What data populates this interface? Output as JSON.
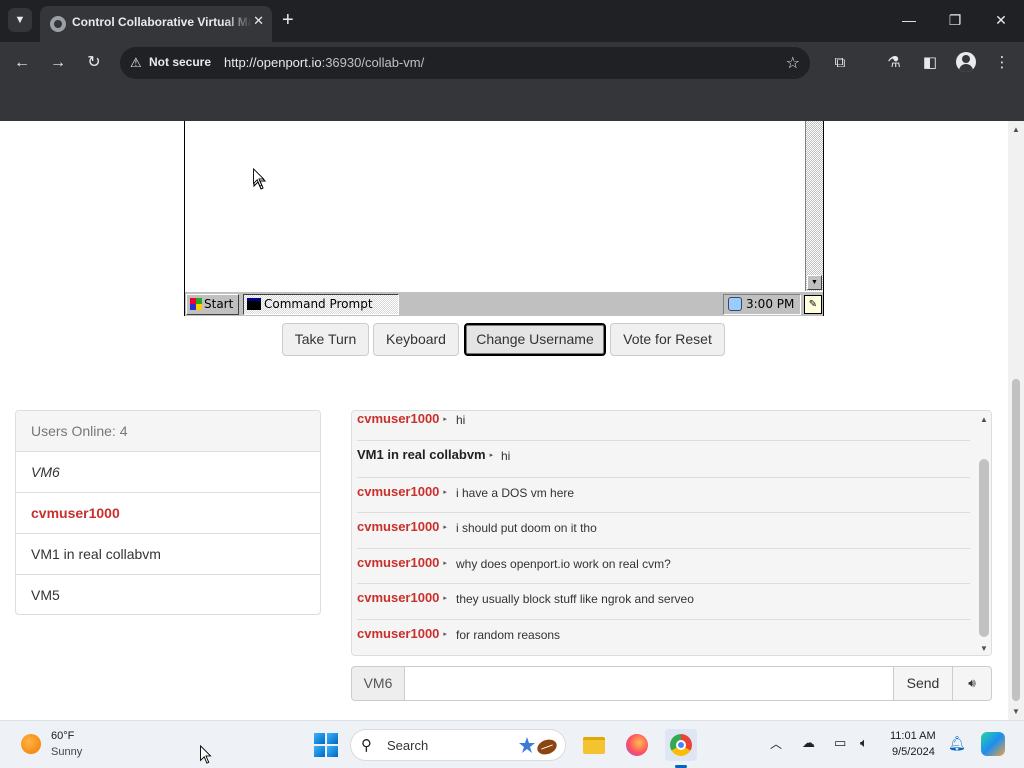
{
  "browser": {
    "tab_title": "Control Collaborative Virtual Machine",
    "tab_list_icon": "chevron-down-icon",
    "security_label": "Not secure",
    "url_host": "http://openport.io",
    "url_rest": ":36930/collab-vm/"
  },
  "vm": {
    "taskbar": {
      "start_label": "Start",
      "window_label": "Command Prompt",
      "clock": "3:00 PM"
    }
  },
  "controls": {
    "take_turn": "Take Turn",
    "keyboard": "Keyboard",
    "change_username": "Change Username",
    "vote_reset": "Vote for Reset"
  },
  "users": {
    "header": "Users Online: 4",
    "list": [
      {
        "name": "VM6",
        "style": "italic"
      },
      {
        "name": "cvmuser1000",
        "style": "highlight"
      },
      {
        "name": "VM1 in real collabvm",
        "style": "normal"
      },
      {
        "name": "VM5",
        "style": "normal"
      }
    ]
  },
  "chat": {
    "messages": [
      {
        "user": "cvmuser1000",
        "text": "hi",
        "admin": false
      },
      {
        "user": "VM1 in real collabvm",
        "text": "hi",
        "admin": true
      },
      {
        "user": "cvmuser1000",
        "text": "i have a DOS vm here",
        "admin": false
      },
      {
        "user": "cvmuser1000",
        "text": "i should put doom on it tho",
        "admin": false
      },
      {
        "user": "cvmuser1000",
        "text": "why does openport.io work on real cvm?",
        "admin": false
      },
      {
        "user": "cvmuser1000",
        "text": "they usually block stuff like ngrok and serveo",
        "admin": false
      },
      {
        "user": "cvmuser1000",
        "text": "for random reasons",
        "admin": false
      }
    ],
    "input_username": "VM6",
    "input_value": "",
    "send_label": "Send"
  },
  "taskbar": {
    "weather_temp": "60°F",
    "weather_desc": "Sunny",
    "search_label": "Search",
    "time": "11:01 AM",
    "date": "9/5/2024"
  },
  "colors": {
    "user_red": "#c9302c",
    "chrome_dark": "#202124",
    "chrome_toolbar": "#35363a",
    "win98_gray": "#c0c0c0"
  }
}
